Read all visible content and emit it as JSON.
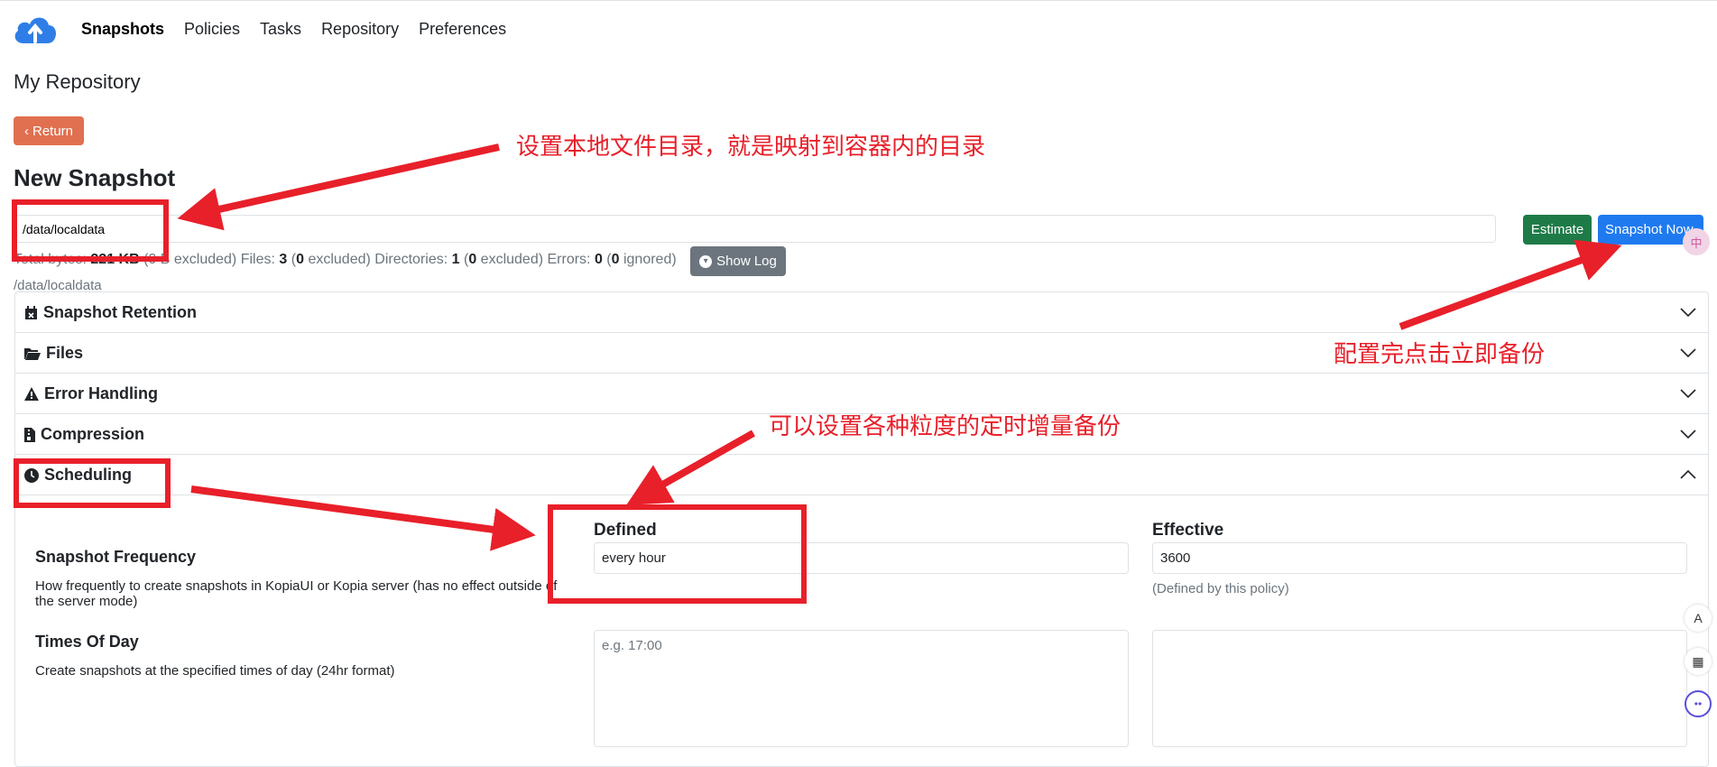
{
  "nav": {
    "items": [
      "Snapshots",
      "Policies",
      "Tasks",
      "Repository",
      "Preferences"
    ],
    "active": "Snapshots"
  },
  "repo_title": "My Repository",
  "return_label": "Return",
  "new_snapshot_title": "New Snapshot",
  "path_value": "/data/localdata",
  "estimate_label": "Estimate",
  "snapshot_now_label": "Snapshot Now",
  "stats": {
    "bytes_prefix": "Total bytes:",
    "bytes": "221 KB",
    "bytes_excl": "(0 B excluded)",
    "files_label": "Files:",
    "files": "3",
    "files_excl": "0",
    "dirs_label": "Directories:",
    "dirs": "1",
    "dirs_excl": "0",
    "errors_label": "Errors:",
    "errors": "0",
    "errors_ign": "0"
  },
  "show_log_label": "Show Log",
  "path_caption": "/data/localdata",
  "sections": [
    {
      "label": "Snapshot Retention",
      "icon": "calendar-icon"
    },
    {
      "label": "Files",
      "icon": "folder-open-icon"
    },
    {
      "label": "Error Handling",
      "icon": "warning-icon"
    },
    {
      "label": "Compression",
      "icon": "file-zip-icon"
    },
    {
      "label": "Scheduling",
      "icon": "clock-icon"
    }
  ],
  "scheduling": {
    "defined_header": "Defined",
    "effective_header": "Effective",
    "frequency_title": "Snapshot Frequency",
    "frequency_desc": "How frequently to create snapshots in KopiaUI or Kopia server (has no effect outside of the server mode)",
    "frequency_defined": "every hour",
    "frequency_effective": "3600",
    "frequency_note": "(Defined by this policy)",
    "tod_title": "Times Of Day",
    "tod_desc": "Create snapshots at the specified times of day (24hr format)",
    "tod_placeholder": "e.g. 17:00"
  },
  "annotations": {
    "path_note": "设置本地文件目录，就是映射到容器内的目录",
    "snapshot_note": "配置完点击立即备份",
    "schedule_note": "可以设置各种粒度的定时增量备份"
  },
  "colors": {
    "annotation": "#e8202a",
    "return": "#e07050",
    "estimate": "#1e7b47",
    "primary": "#1f7af0",
    "secondary": "#6c757d"
  }
}
